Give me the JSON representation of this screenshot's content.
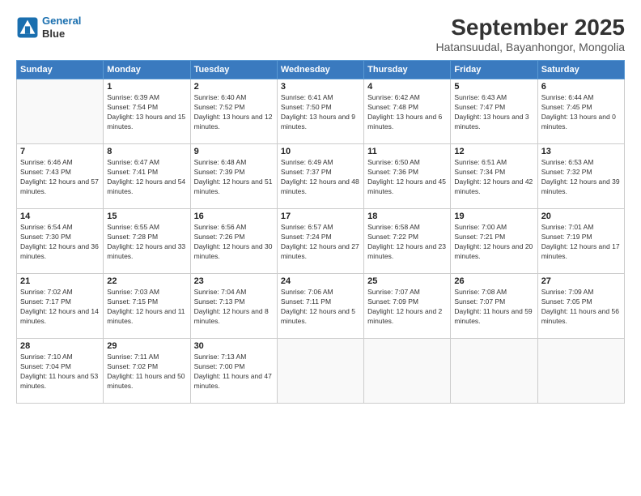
{
  "logo": {
    "line1": "General",
    "line2": "Blue"
  },
  "title": "September 2025",
  "subtitle": "Hatansuudal, Bayanhongor, Mongolia",
  "weekdays": [
    "Sunday",
    "Monday",
    "Tuesday",
    "Wednesday",
    "Thursday",
    "Friday",
    "Saturday"
  ],
  "weeks": [
    [
      {
        "day": "",
        "empty": true
      },
      {
        "day": "1",
        "sunrise": "6:39 AM",
        "sunset": "7:54 PM",
        "daylight": "13 hours and 15 minutes."
      },
      {
        "day": "2",
        "sunrise": "6:40 AM",
        "sunset": "7:52 PM",
        "daylight": "13 hours and 12 minutes."
      },
      {
        "day": "3",
        "sunrise": "6:41 AM",
        "sunset": "7:50 PM",
        "daylight": "13 hours and 9 minutes."
      },
      {
        "day": "4",
        "sunrise": "6:42 AM",
        "sunset": "7:48 PM",
        "daylight": "13 hours and 6 minutes."
      },
      {
        "day": "5",
        "sunrise": "6:43 AM",
        "sunset": "7:47 PM",
        "daylight": "13 hours and 3 minutes."
      },
      {
        "day": "6",
        "sunrise": "6:44 AM",
        "sunset": "7:45 PM",
        "daylight": "13 hours and 0 minutes."
      }
    ],
    [
      {
        "day": "7",
        "sunrise": "6:46 AM",
        "sunset": "7:43 PM",
        "daylight": "12 hours and 57 minutes."
      },
      {
        "day": "8",
        "sunrise": "6:47 AM",
        "sunset": "7:41 PM",
        "daylight": "12 hours and 54 minutes."
      },
      {
        "day": "9",
        "sunrise": "6:48 AM",
        "sunset": "7:39 PM",
        "daylight": "12 hours and 51 minutes."
      },
      {
        "day": "10",
        "sunrise": "6:49 AM",
        "sunset": "7:37 PM",
        "daylight": "12 hours and 48 minutes."
      },
      {
        "day": "11",
        "sunrise": "6:50 AM",
        "sunset": "7:36 PM",
        "daylight": "12 hours and 45 minutes."
      },
      {
        "day": "12",
        "sunrise": "6:51 AM",
        "sunset": "7:34 PM",
        "daylight": "12 hours and 42 minutes."
      },
      {
        "day": "13",
        "sunrise": "6:53 AM",
        "sunset": "7:32 PM",
        "daylight": "12 hours and 39 minutes."
      }
    ],
    [
      {
        "day": "14",
        "sunrise": "6:54 AM",
        "sunset": "7:30 PM",
        "daylight": "12 hours and 36 minutes."
      },
      {
        "day": "15",
        "sunrise": "6:55 AM",
        "sunset": "7:28 PM",
        "daylight": "12 hours and 33 minutes."
      },
      {
        "day": "16",
        "sunrise": "6:56 AM",
        "sunset": "7:26 PM",
        "daylight": "12 hours and 30 minutes."
      },
      {
        "day": "17",
        "sunrise": "6:57 AM",
        "sunset": "7:24 PM",
        "daylight": "12 hours and 27 minutes."
      },
      {
        "day": "18",
        "sunrise": "6:58 AM",
        "sunset": "7:22 PM",
        "daylight": "12 hours and 23 minutes."
      },
      {
        "day": "19",
        "sunrise": "7:00 AM",
        "sunset": "7:21 PM",
        "daylight": "12 hours and 20 minutes."
      },
      {
        "day": "20",
        "sunrise": "7:01 AM",
        "sunset": "7:19 PM",
        "daylight": "12 hours and 17 minutes."
      }
    ],
    [
      {
        "day": "21",
        "sunrise": "7:02 AM",
        "sunset": "7:17 PM",
        "daylight": "12 hours and 14 minutes."
      },
      {
        "day": "22",
        "sunrise": "7:03 AM",
        "sunset": "7:15 PM",
        "daylight": "12 hours and 11 minutes."
      },
      {
        "day": "23",
        "sunrise": "7:04 AM",
        "sunset": "7:13 PM",
        "daylight": "12 hours and 8 minutes."
      },
      {
        "day": "24",
        "sunrise": "7:06 AM",
        "sunset": "7:11 PM",
        "daylight": "12 hours and 5 minutes."
      },
      {
        "day": "25",
        "sunrise": "7:07 AM",
        "sunset": "7:09 PM",
        "daylight": "12 hours and 2 minutes."
      },
      {
        "day": "26",
        "sunrise": "7:08 AM",
        "sunset": "7:07 PM",
        "daylight": "11 hours and 59 minutes."
      },
      {
        "day": "27",
        "sunrise": "7:09 AM",
        "sunset": "7:05 PM",
        "daylight": "11 hours and 56 minutes."
      }
    ],
    [
      {
        "day": "28",
        "sunrise": "7:10 AM",
        "sunset": "7:04 PM",
        "daylight": "11 hours and 53 minutes."
      },
      {
        "day": "29",
        "sunrise": "7:11 AM",
        "sunset": "7:02 PM",
        "daylight": "11 hours and 50 minutes."
      },
      {
        "day": "30",
        "sunrise": "7:13 AM",
        "sunset": "7:00 PM",
        "daylight": "11 hours and 47 minutes."
      },
      {
        "day": "",
        "empty": true
      },
      {
        "day": "",
        "empty": true
      },
      {
        "day": "",
        "empty": true
      },
      {
        "day": "",
        "empty": true
      }
    ]
  ]
}
